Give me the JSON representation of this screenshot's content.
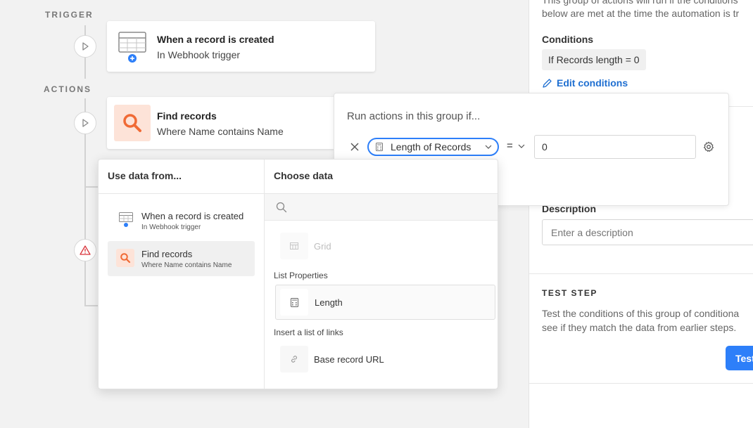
{
  "canvas": {
    "trigger_label": "TRIGGER",
    "actions_label": "ACTIONS",
    "trigger_card": {
      "title": "When a record is created",
      "subtitle": "In Webhook trigger"
    },
    "find_card": {
      "title": "Find records",
      "subtitle": "Where Name contains Name"
    }
  },
  "right_panel": {
    "intro_line1": "This group of actions will run if the conditions",
    "intro_line2": "below are met at the time the automation is tr",
    "conditions_heading": "Conditions",
    "condition_chip": "If Records length = 0",
    "edit_conditions": "Edit conditions",
    "description_heading": "Description",
    "description_placeholder": "Enter a description",
    "test_step_heading": "TEST STEP",
    "test_text_line1": "Test the conditions of this group of conditiona",
    "test_text_line2": "see if they match the data from earlier steps.",
    "test_button": "Test"
  },
  "condition_popover": {
    "heading": "Run actions in this group if...",
    "field_pill": "Length of Records",
    "operator": "=",
    "value": "0"
  },
  "picker": {
    "left_heading": "Use data from...",
    "right_heading": "Choose data",
    "search_placeholder": "",
    "sources": [
      {
        "title": "When a record is created",
        "subtitle": "In Webhook trigger"
      },
      {
        "title": "Find records",
        "subtitle": "Where Name contains Name"
      }
    ],
    "faded_item": "Grid",
    "list_properties_label": "List Properties",
    "length_item": "Length",
    "links_label": "Insert a list of links",
    "base_url_item": "Base record URL"
  },
  "colors": {
    "accent_blue": "#2d7ff9",
    "link_blue": "#1f6fd1",
    "search_orange": "#f06a35",
    "orange_bg": "#fde3d8",
    "warning_red": "#d9333a"
  }
}
